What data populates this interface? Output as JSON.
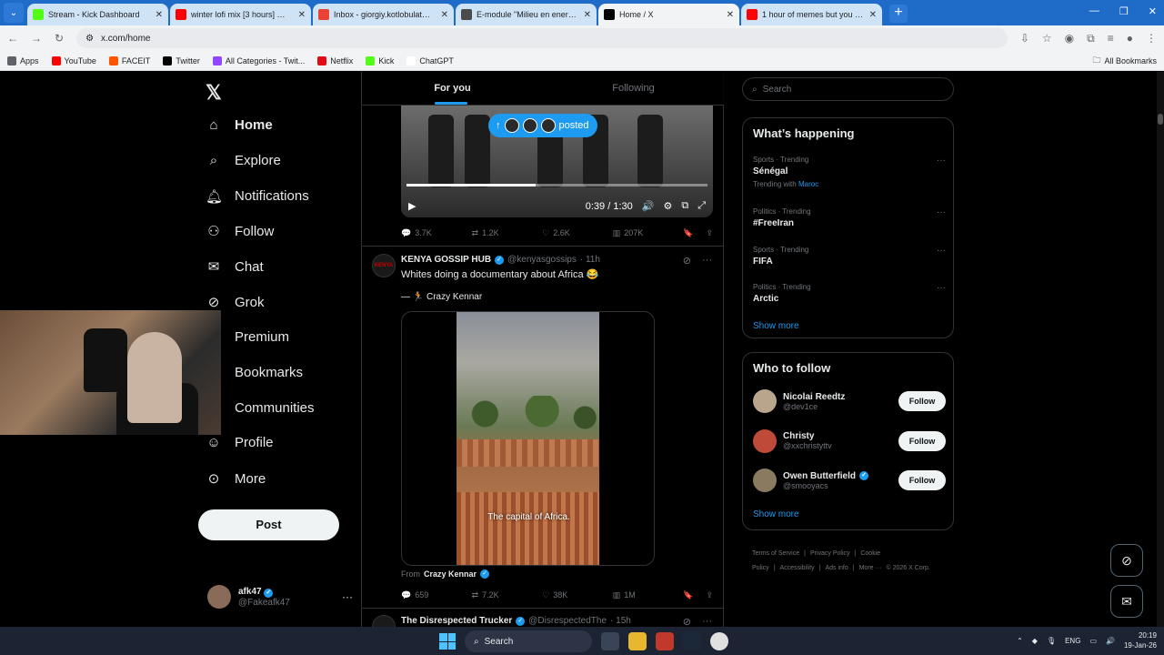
{
  "browser": {
    "tabs": [
      {
        "title": "Stream - Kick Dashboard",
        "color": "#53fc18",
        "active": false
      },
      {
        "title": "winter lofi mix [3 hours] ❄️ rela",
        "color": "#ff0000",
        "active": false
      },
      {
        "title": "Inbox - giorgiy.kotlobulat@vda",
        "color": "#ea4335",
        "active": false
      },
      {
        "title": "E-module \"Milieu en energie in",
        "color": "#4a4a4a",
        "active": false
      },
      {
        "title": "Home / X",
        "color": "#000000",
        "active": true
      },
      {
        "title": "1 hour of memes but you will la",
        "color": "#ff0000",
        "active": false
      }
    ],
    "url": "x.com/home",
    "bookmarks": [
      {
        "label": "Apps",
        "color": "#5f6368"
      },
      {
        "label": "YouTube",
        "color": "#ff0000"
      },
      {
        "label": "FACEIT",
        "color": "#ff5500"
      },
      {
        "label": "Twitter",
        "color": "#000000"
      },
      {
        "label": "All Categories - Twit...",
        "color": "#9146ff"
      },
      {
        "label": "Netflix",
        "color": "#e50914"
      },
      {
        "label": "Kick",
        "color": "#53fc18"
      },
      {
        "label": "ChatGPT",
        "color": "#ffffff"
      }
    ],
    "all_bookmarks": "All Bookmarks"
  },
  "nav": {
    "items": [
      {
        "label": "Home",
        "icon": "home-icon"
      },
      {
        "label": "Explore",
        "icon": "search-icon"
      },
      {
        "label": "Notifications",
        "icon": "bell-icon"
      },
      {
        "label": "Follow",
        "icon": "add-user-icon"
      },
      {
        "label": "Chat",
        "icon": "mail-icon"
      },
      {
        "label": "Grok",
        "icon": "grok-icon"
      },
      {
        "label": "Premium",
        "icon": "x-icon"
      },
      {
        "label": "Bookmarks",
        "icon": "bookmark-icon"
      },
      {
        "label": "Communities",
        "icon": "people-icon"
      },
      {
        "label": "Profile",
        "icon": "person-icon"
      },
      {
        "label": "More",
        "icon": "more-circle-icon"
      }
    ],
    "post_label": "Post",
    "account": {
      "name": "afk47",
      "handle": "@Fakeafk47"
    }
  },
  "feed": {
    "tabs": [
      "For you",
      "Following"
    ],
    "posted_label": "posted",
    "video1": {
      "time": "0:39 / 1:30",
      "progress": 0.43
    },
    "tweet1_stats": {
      "replies": "3.7K",
      "reposts": "1.2K",
      "likes": "2.6K",
      "views": "207K"
    },
    "tweet2": {
      "name": "KENYA GOSSIP HUB",
      "handle": "@kenyasgossips",
      "time": "· 11h",
      "text": "Whites doing a documentary about Africa 😂",
      "quote": "— 🏃 Crazy Kennar",
      "caption": "The capital of Africa.",
      "from_label": "From",
      "from_name": "Crazy Kennar",
      "stats": {
        "replies": "659",
        "reposts": "7.2K",
        "likes": "38K",
        "views": "1M"
      }
    },
    "tweet3": {
      "name": "The Disrespected Trucker",
      "handle": "@DisrespectedThe",
      "time": "· 15h"
    }
  },
  "right": {
    "search_placeholder": "Search",
    "happening_title": "What’s happening",
    "trends": [
      {
        "context": "Sports · Trending",
        "topic": "Sénégal",
        "with_label": "Trending with",
        "with": "Maroc"
      },
      {
        "context": "Politics · Trending",
        "topic": "#FreeIran",
        "with_label": "",
        "with": ""
      },
      {
        "context": "Sports · Trending",
        "topic": "FIFA",
        "with_label": "",
        "with": ""
      },
      {
        "context": "Politics · Trending",
        "topic": "Arctic",
        "with_label": "",
        "with": ""
      }
    ],
    "show_more": "Show more",
    "who_title": "Who to follow",
    "who": [
      {
        "name": "Nicolai Reedtz",
        "handle": "@dev1ce",
        "verified": false,
        "button": "Follow",
        "color": "#b8a58c"
      },
      {
        "name": "Christy",
        "handle": "@xxchristyttv",
        "verified": false,
        "button": "Follow",
        "color": "#c04a3a"
      },
      {
        "name": "Owen Butterfield",
        "handle": "@smooyacs",
        "verified": true,
        "button": "Follow",
        "color": "#8a7a60"
      }
    ],
    "footer": [
      "Terms of Service",
      "|",
      "Privacy Policy",
      "|",
      "Cookie Policy",
      "|",
      "Accessibility",
      "|",
      "Ads info",
      "|",
      "More ···",
      "© 2026 X Corp."
    ]
  },
  "taskbar": {
    "search": "Search",
    "lang": "ENG",
    "time": "20:19",
    "date": "19-Jan-26"
  },
  "colors": {
    "accent": "#1d9bf0",
    "background": "#000000",
    "border": "#2f3336"
  }
}
